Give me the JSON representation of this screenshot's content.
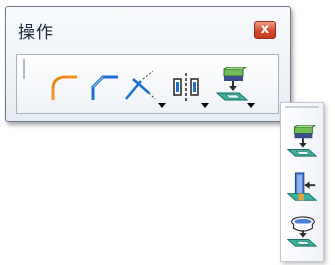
{
  "window": {
    "title": "操作",
    "close_label": "x"
  },
  "toolbar": {
    "tools": [
      {
        "icon": "fillet-icon"
      },
      {
        "icon": "chamfer-icon"
      },
      {
        "icon": "trim-icon",
        "has_dropdown": true
      },
      {
        "icon": "symmetry-icon",
        "has_dropdown": true
      },
      {
        "icon": "project-icon",
        "has_dropdown": true
      }
    ]
  },
  "flyout": {
    "tools": [
      {
        "icon": "project-icon"
      },
      {
        "icon": "intersect-icon"
      },
      {
        "icon": "silhouette-icon"
      }
    ]
  }
}
